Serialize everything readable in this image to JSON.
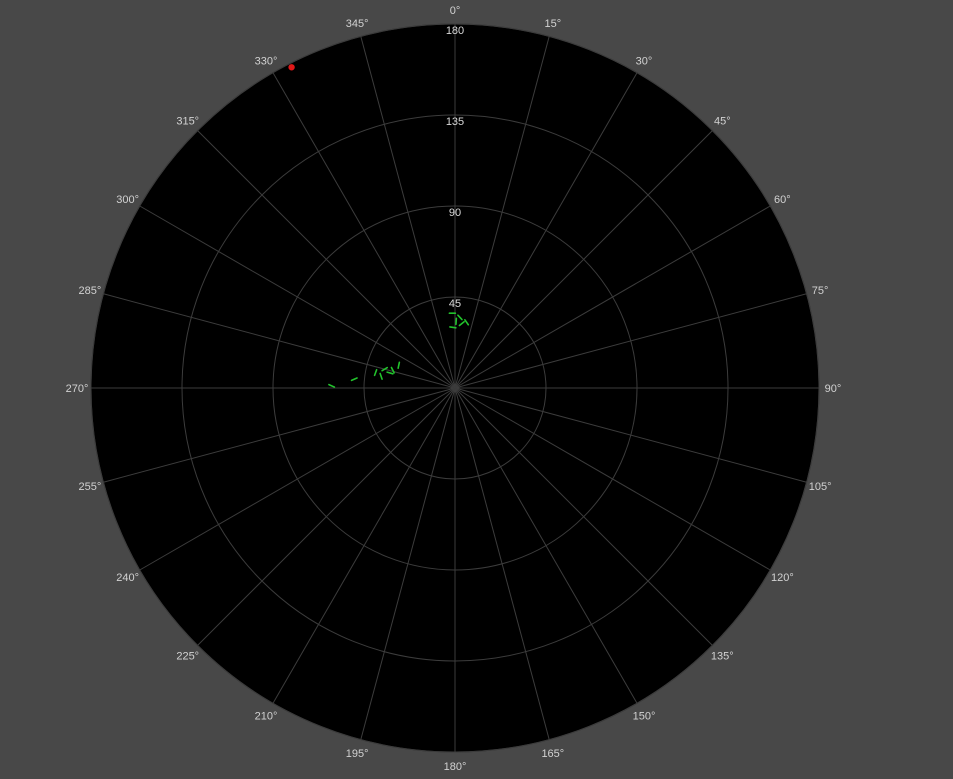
{
  "chart_data": {
    "type": "scatter",
    "coordinate_system": "polar",
    "title": "",
    "angle_axis": {
      "unit": "degrees",
      "direction": "clockwise",
      "zero_at": "top",
      "tick_labels": [
        "0°",
        "15°",
        "30°",
        "45°",
        "60°",
        "75°",
        "90°",
        "105°",
        "120°",
        "135°",
        "150°",
        "165°",
        "180°",
        "195°",
        "210°",
        "225°",
        "240°",
        "255°",
        "270°",
        "285°",
        "300°",
        "315°",
        "330°",
        "345°"
      ],
      "tick_values": [
        0,
        15,
        30,
        45,
        60,
        75,
        90,
        105,
        120,
        135,
        150,
        165,
        180,
        195,
        210,
        225,
        240,
        255,
        270,
        285,
        300,
        315,
        330,
        345
      ]
    },
    "radial_axis": {
      "range": [
        0,
        180
      ],
      "tick_values": [
        45,
        90,
        135,
        180
      ],
      "tick_labels": [
        "45",
        "90",
        "135",
        "180"
      ]
    },
    "grid": true,
    "series": [
      {
        "color": "#22c22c",
        "marker": "dash",
        "points": [
          {
            "angle": 358,
            "r": 37
          },
          {
            "angle": 4,
            "r": 35
          },
          {
            "angle": 1,
            "r": 33
          },
          {
            "angle": 6,
            "r": 32
          },
          {
            "angle": 358,
            "r": 30
          },
          {
            "angle": 10,
            "r": 33
          },
          {
            "angle": 292,
            "r": 30
          },
          {
            "angle": 285,
            "r": 36
          },
          {
            "angle": 283,
            "r": 33
          },
          {
            "angle": 286,
            "r": 32
          },
          {
            "angle": 281,
            "r": 40
          },
          {
            "angle": 275,
            "r": 50
          },
          {
            "angle": 271,
            "r": 61
          },
          {
            "angle": 279,
            "r": 37
          }
        ]
      },
      {
        "color": "#e01818",
        "marker": "dot",
        "points": [
          {
            "angle": 333,
            "r": 178
          }
        ]
      }
    ],
    "colors": {
      "plot_background": "#000000",
      "page_background": "#484848",
      "grid": "#3c3c3c",
      "labels": "#d2d2d2"
    }
  }
}
